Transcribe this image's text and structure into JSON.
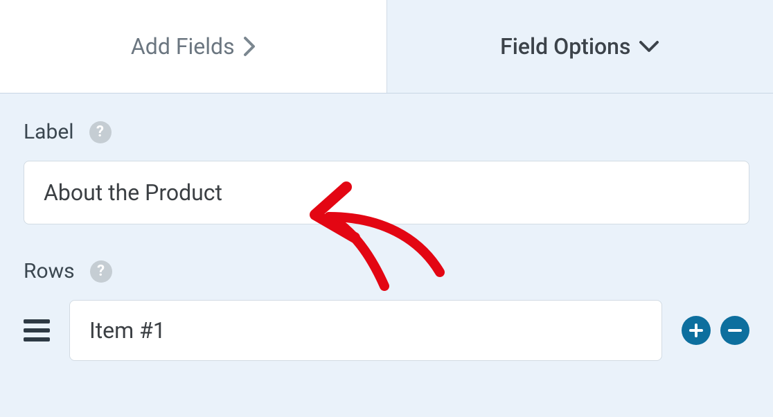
{
  "tabs": {
    "add_fields": "Add Fields",
    "field_options": "Field Options"
  },
  "panel": {
    "label_section": {
      "title": "Label",
      "value": "About the Product"
    },
    "rows_section": {
      "title": "Rows",
      "items": [
        {
          "value": "Item #1"
        }
      ]
    }
  },
  "icons": {
    "help": "?",
    "plus": "+",
    "minus": "−"
  }
}
